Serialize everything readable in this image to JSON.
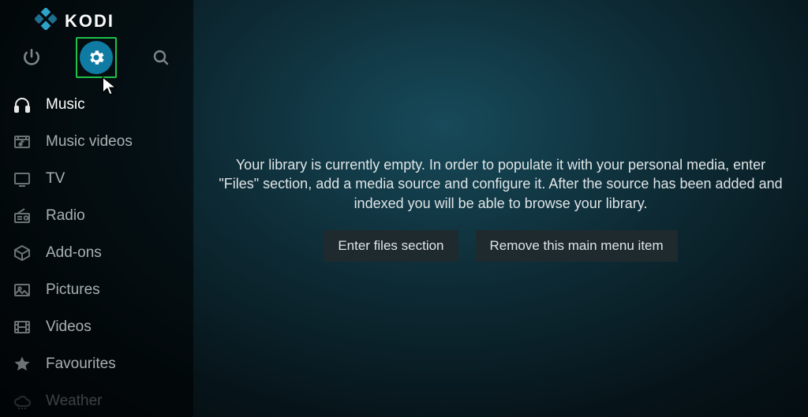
{
  "app": {
    "name": "KODI"
  },
  "toolbar": {
    "power": "Power",
    "settings": "Settings",
    "search": "Search"
  },
  "sidebar": {
    "items": [
      {
        "label": "Music",
        "icon": "headphones-icon",
        "selected": true
      },
      {
        "label": "Music videos",
        "icon": "music-video-icon"
      },
      {
        "label": "TV",
        "icon": "tv-icon"
      },
      {
        "label": "Radio",
        "icon": "radio-icon"
      },
      {
        "label": "Add-ons",
        "icon": "box-icon"
      },
      {
        "label": "Pictures",
        "icon": "picture-icon"
      },
      {
        "label": "Videos",
        "icon": "film-icon"
      },
      {
        "label": "Favourites",
        "icon": "star-icon"
      },
      {
        "label": "Weather",
        "icon": "cloud-icon",
        "faded": true
      }
    ]
  },
  "main": {
    "empty_message": "Your library is currently empty. In order to populate it with your personal media, enter \"Files\" section, add a media source and configure it. After the source has been added and indexed you will be able to browse your library.",
    "enter_files_label": "Enter files section",
    "remove_menu_label": "Remove this main menu item"
  }
}
